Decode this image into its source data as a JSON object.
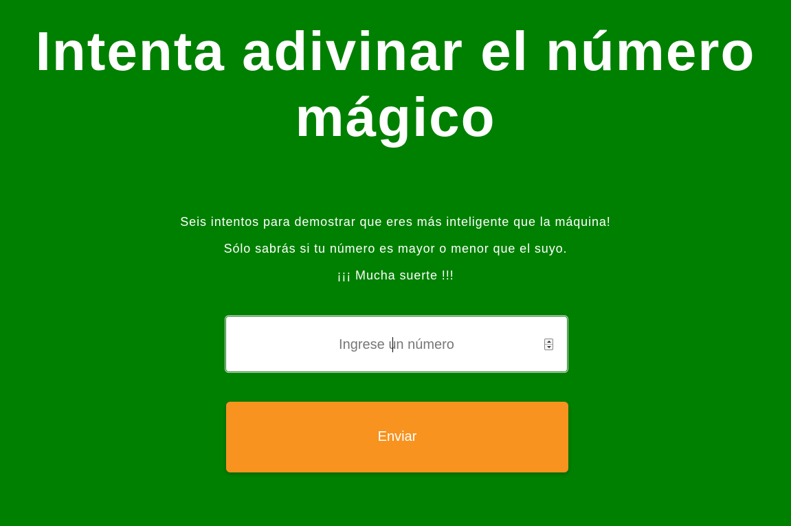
{
  "page": {
    "title": "Intenta adivinar el número mágico",
    "background_color": "#008000"
  },
  "intro": {
    "line1": "Seis intentos para demostrar que eres más inteligente que la máquina!",
    "line2": "Sólo sabrás si tu número es mayor o menor que el suyo.",
    "line3": "¡¡¡ Mucha suerte !!!"
  },
  "form": {
    "number_input": {
      "placeholder": "Ingrese un número",
      "value": ""
    },
    "submit_label": "Enviar",
    "submit_color": "#f7931e"
  }
}
